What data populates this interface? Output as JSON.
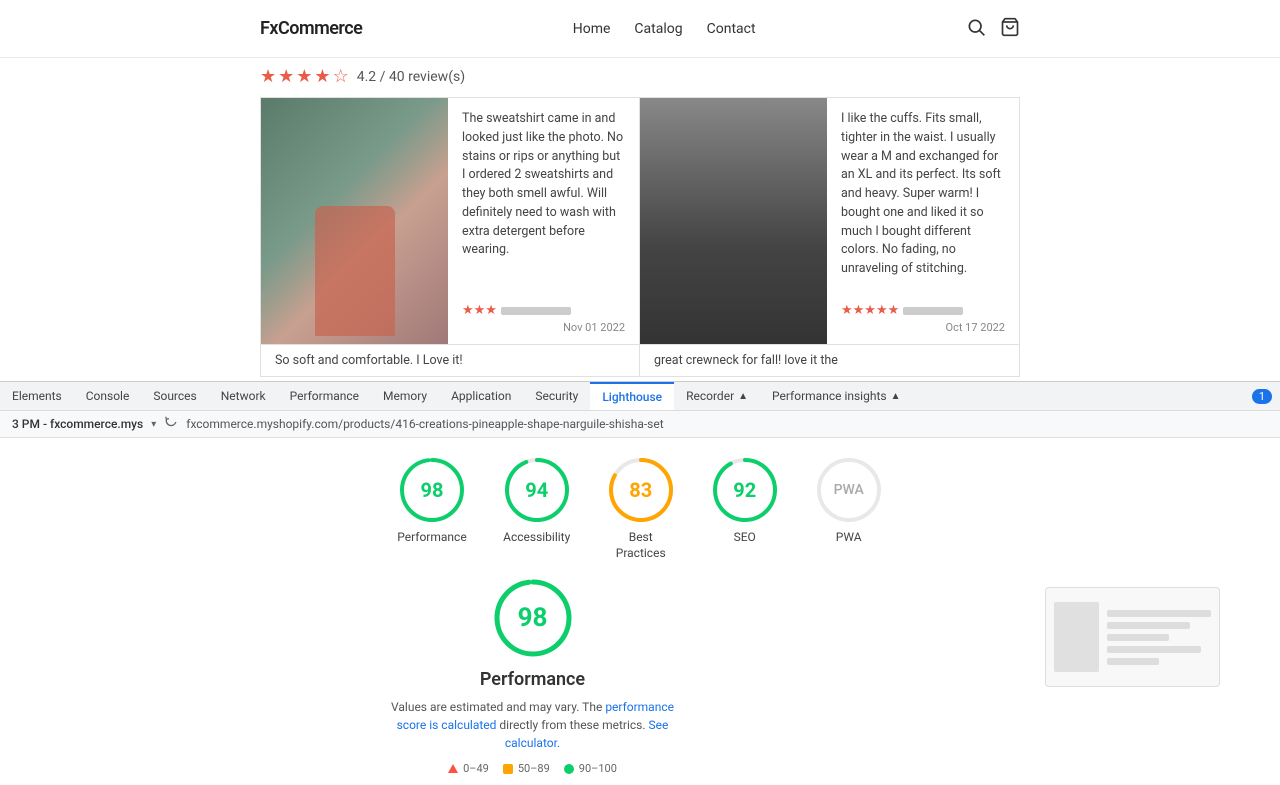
{
  "site": {
    "logo": "FxCommerce",
    "nav": [
      "Home",
      "Catalog",
      "Contact"
    ]
  },
  "reviews": {
    "rating": "4.2",
    "count": "40",
    "review_label": "review(s)",
    "review1": {
      "body": "The sweatshirt came in and looked just like the photo. No stains or rips or anything but I ordered 2 sweatshirts and they both smell awful. Will definitely need to wash with extra detergent before wearing.",
      "date": "Nov 01 2022",
      "stars": 3
    },
    "review2": {
      "body": "I like the cuffs. Fits small, tighter in the waist. I usually wear a M and exchanged for an XL and its perfect. Its soft and heavy. Super warm! I bought one and liked it so much I bought different colors. No fading, no unraveling of stitching.",
      "date": "Oct 17 2022",
      "stars": 5
    },
    "review3_body": "So soft and comfortable. I Love it!",
    "review4_body": "great crewneck for fall! love it the"
  },
  "devtools": {
    "tabs": [
      "Elements",
      "Console",
      "Sources",
      "Network",
      "Performance",
      "Memory",
      "Application",
      "Security",
      "Lighthouse",
      "Recorder",
      "Performance insights"
    ],
    "active_tab": "Lighthouse",
    "badge": "1",
    "url_domain": "3 PM - fxcommerce.mys",
    "full_url": "fxcommerce.myshopify.com/products/416-creations-pineapple-shape-narguile-shisha-set"
  },
  "lighthouse": {
    "scores": [
      {
        "id": "performance",
        "value": 98,
        "label": "Performance",
        "color": "green"
      },
      {
        "id": "accessibility",
        "value": 94,
        "label": "Accessibility",
        "color": "green"
      },
      {
        "id": "best-practices",
        "value": 83,
        "label": "Best Practices",
        "color": "orange"
      },
      {
        "id": "seo",
        "value": 92,
        "label": "SEO",
        "color": "green"
      },
      {
        "id": "pwa",
        "value": null,
        "label": "PWA",
        "color": "gray"
      }
    ],
    "performance_section": {
      "score": 98,
      "title": "Performance",
      "desc_text": "Values are estimated and may vary. The",
      "link1_text": "performance score is calculated",
      "link1_suffix": " directly from these metrics.",
      "link2_text": "See calculator.",
      "legend": [
        {
          "range": "0–49",
          "type": "red"
        },
        {
          "range": "50–89",
          "type": "orange"
        },
        {
          "range": "90–100",
          "type": "green"
        }
      ]
    }
  }
}
